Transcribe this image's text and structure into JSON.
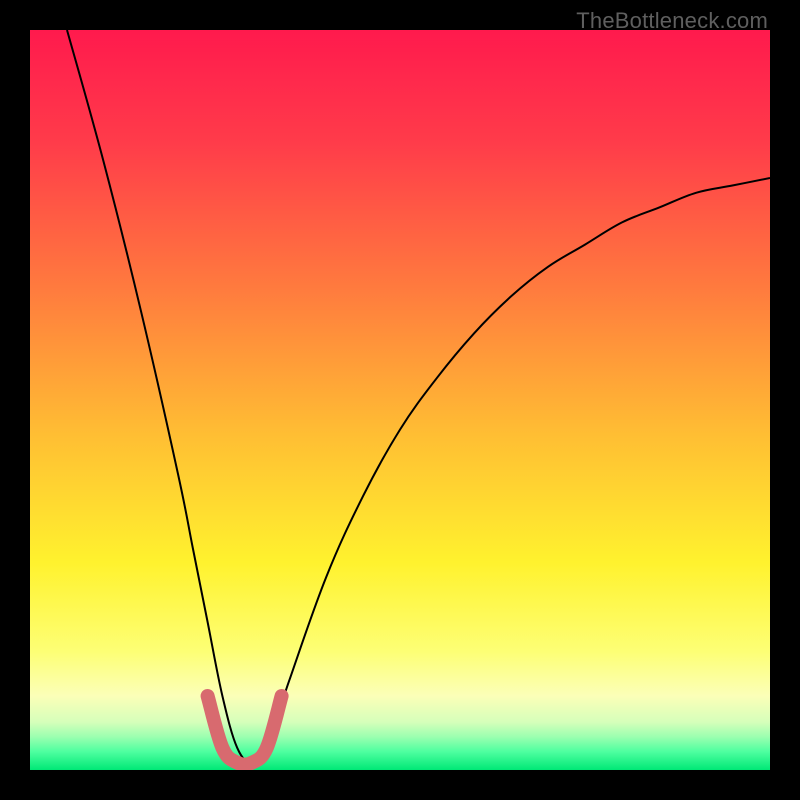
{
  "watermark": "TheBottleneck.com",
  "chart_data": {
    "type": "line",
    "title": "",
    "xlabel": "",
    "ylabel": "",
    "xlim": [
      0,
      100
    ],
    "ylim": [
      0,
      100
    ],
    "grid": false,
    "legend": false,
    "annotations": [],
    "series": [
      {
        "name": "black-curve",
        "x": [
          5,
          10,
          15,
          20,
          22,
          24,
          26,
          28,
          30,
          32,
          35,
          40,
          45,
          50,
          55,
          60,
          65,
          70,
          75,
          80,
          85,
          90,
          95,
          100
        ],
        "y": [
          100,
          82,
          62,
          40,
          30,
          20,
          10,
          3,
          1,
          3,
          12,
          26,
          37,
          46,
          53,
          59,
          64,
          68,
          71,
          74,
          76,
          78,
          79,
          80
        ],
        "color": "#000000",
        "stroke_width": 2
      },
      {
        "name": "red-overlay",
        "x": [
          24,
          26,
          28,
          30,
          32,
          34
        ],
        "y": [
          10,
          3,
          1,
          1,
          3,
          10
        ],
        "color": "#d86a6f",
        "stroke_width": 14
      }
    ],
    "background_gradient": {
      "stops": [
        {
          "offset": 0.0,
          "color": "#ff1a4d"
        },
        {
          "offset": 0.15,
          "color": "#ff3b4a"
        },
        {
          "offset": 0.35,
          "color": "#ff7b3e"
        },
        {
          "offset": 0.55,
          "color": "#ffbf33"
        },
        {
          "offset": 0.72,
          "color": "#fff22e"
        },
        {
          "offset": 0.84,
          "color": "#fdff75"
        },
        {
          "offset": 0.9,
          "color": "#fbffb8"
        },
        {
          "offset": 0.935,
          "color": "#d6ffba"
        },
        {
          "offset": 0.955,
          "color": "#9cffb0"
        },
        {
          "offset": 0.975,
          "color": "#4fffa0"
        },
        {
          "offset": 1.0,
          "color": "#00e876"
        }
      ]
    }
  }
}
